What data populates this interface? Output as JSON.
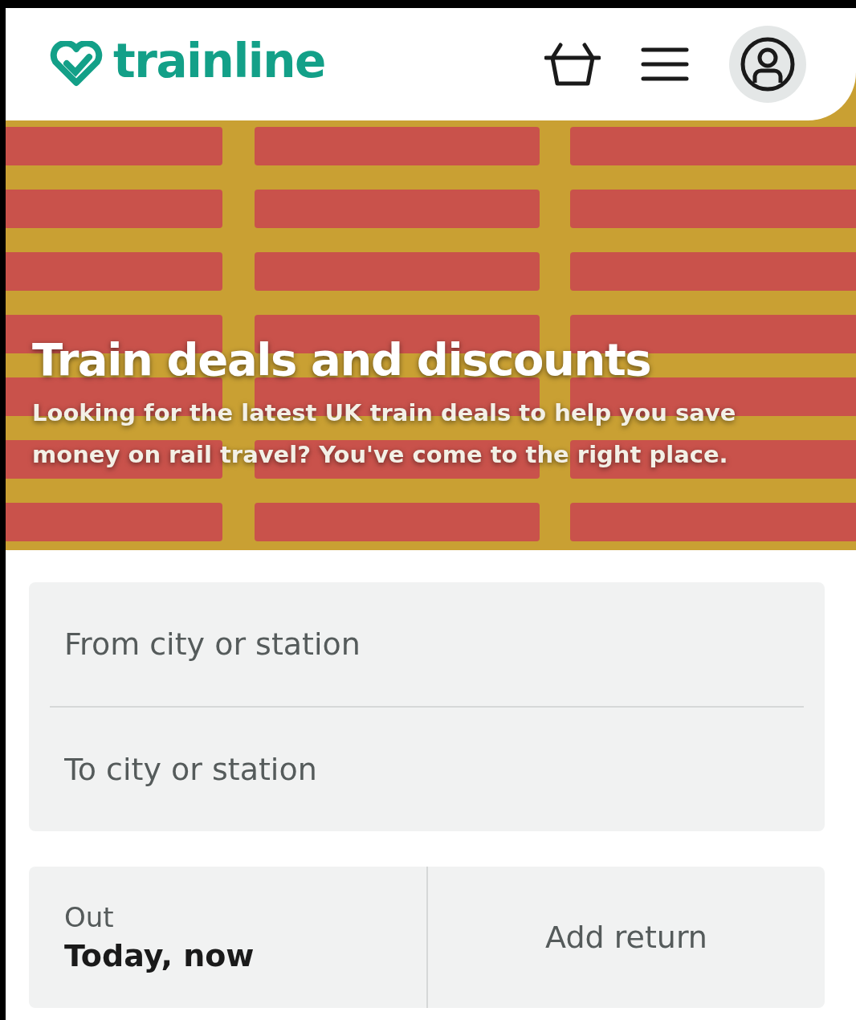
{
  "header": {
    "logo": "trainline"
  },
  "hero": {
    "title": "Train deals and discounts",
    "subtitle": "Looking for the latest UK train deals to help you save money on rail travel? You've come to the right place."
  },
  "journey": {
    "from": {
      "placeholder": "From city or station"
    },
    "to": {
      "placeholder": "To city or station"
    }
  },
  "dates": {
    "out_label": "Out",
    "out_value": "Today, now",
    "return": "Add return"
  }
}
